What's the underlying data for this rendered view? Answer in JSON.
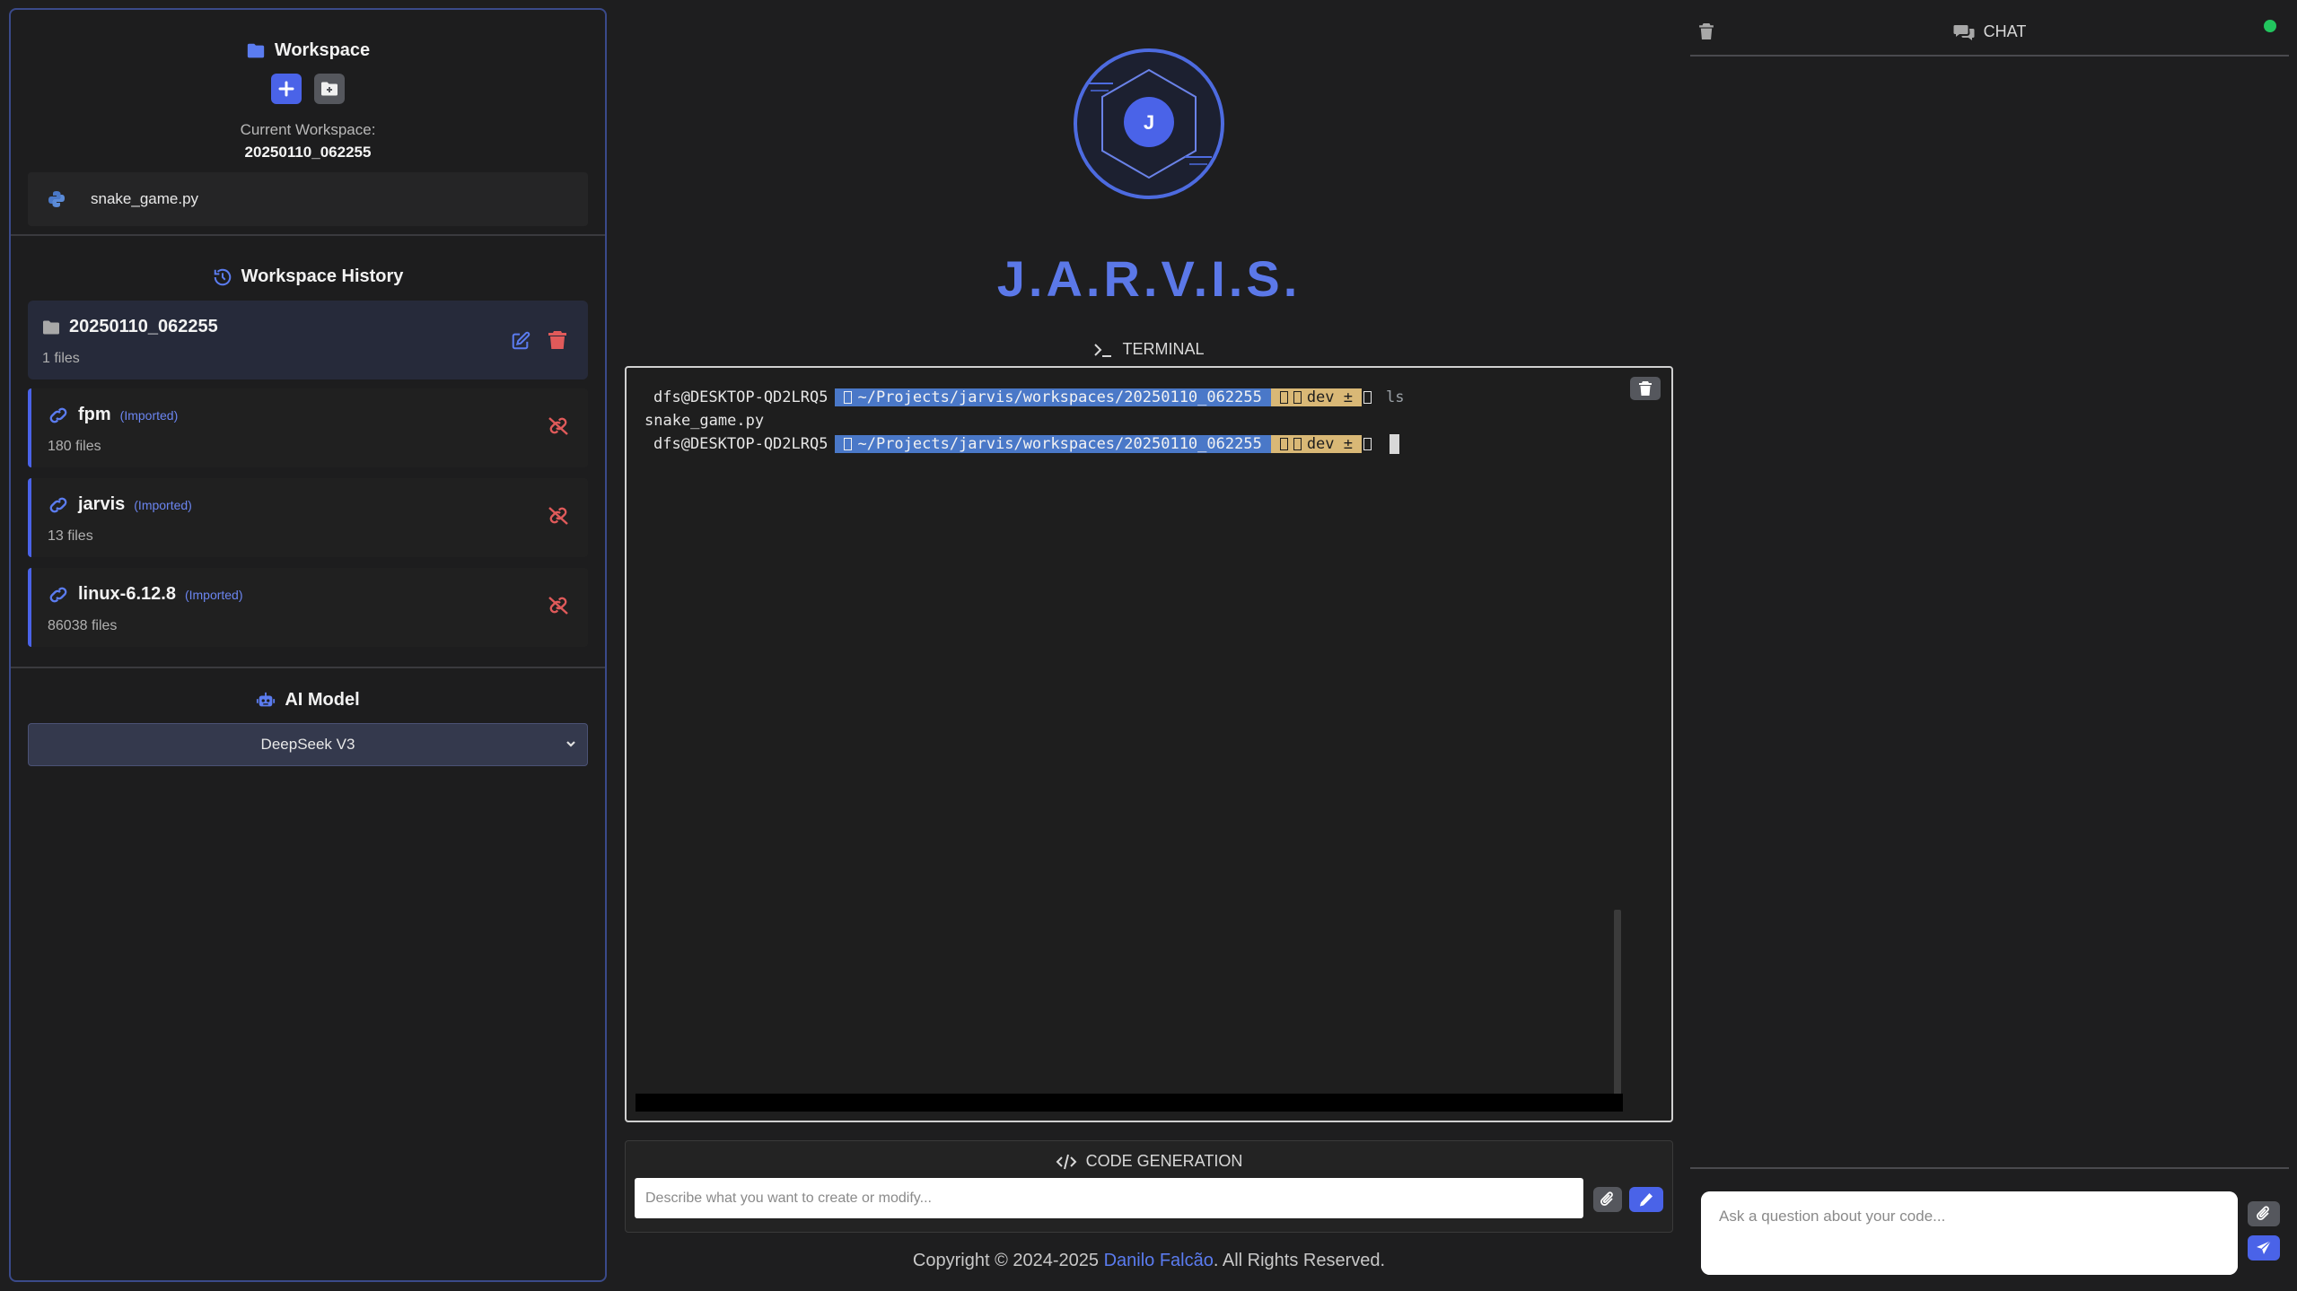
{
  "workspace": {
    "title": "Workspace",
    "current_label": "Current Workspace:",
    "current_value": "20250110_062255",
    "files": [
      {
        "name": "snake_game.py",
        "icon": "python-icon"
      }
    ]
  },
  "history": {
    "title": "Workspace History",
    "current": {
      "name": "20250110_062255",
      "count": "1 files"
    },
    "imported": [
      {
        "name": "fpm",
        "tag": "(Imported)",
        "count": "180 files"
      },
      {
        "name": "jarvis",
        "tag": "(Imported)",
        "count": "13 files"
      },
      {
        "name": "linux-6.12.8",
        "tag": "(Imported)",
        "count": "86038 files"
      }
    ]
  },
  "ai_model": {
    "title": "AI Model",
    "selected": "DeepSeek V3"
  },
  "brand": {
    "logo_letter": "J",
    "title": "J.A.R.V.I.S."
  },
  "terminal": {
    "label": "TERMINAL",
    "lines": [
      {
        "user": "dfs@DESKTOP-QD2LRQ5",
        "path": "~/Projects/jarvis/workspaces/20250110_062255",
        "git": "dev ±",
        "cmd": "ls"
      },
      {
        "output": "snake_game.py"
      },
      {
        "user": "dfs@DESKTOP-QD2LRQ5",
        "path": "~/Projects/jarvis/workspaces/20250110_062255",
        "git": "dev ±",
        "cmd": ""
      }
    ]
  },
  "codegen": {
    "label": "CODE GENERATION",
    "placeholder": "Describe what you want to create or modify..."
  },
  "footer": {
    "prefix": "Copyright © 2024-2025 ",
    "author": "Danilo Falcão",
    "suffix": ". All Rights Reserved."
  },
  "chat": {
    "title": "CHAT",
    "placeholder": "Ask a question about your code...",
    "status_color": "#22c55e"
  },
  "colors": {
    "accent": "#4a63e8",
    "brand": "#5b78e8",
    "danger": "#e05a5a"
  }
}
